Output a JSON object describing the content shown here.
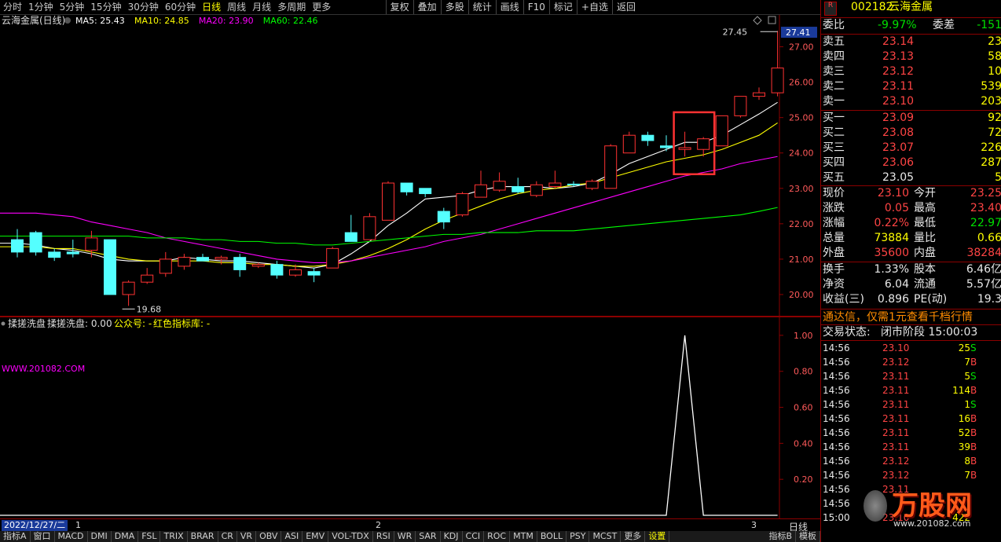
{
  "toolbar": {
    "periods": [
      "分时",
      "1分钟",
      "5分钟",
      "15分钟",
      "30分钟",
      "60分钟",
      "日线",
      "周线",
      "月线",
      "多周期",
      "更多"
    ],
    "active_period": "日线",
    "tools": [
      "复权",
      "叠加",
      "多股",
      "统计",
      "画线",
      "F10",
      "标记",
      "+自选",
      "返回"
    ]
  },
  "main": {
    "stock_title": "云海金属(日线)",
    "ma_labels": [
      {
        "name": "MA5",
        "value": "MA5: 25.43",
        "color": "#ffffff"
      },
      {
        "name": "MA10",
        "value": "MA10: 24.85",
        "color": "#ffff00"
      },
      {
        "name": "MA20",
        "value": "MA20: 23.90",
        "color": "#ff00ff"
      },
      {
        "name": "MA60",
        "value": "MA60: 22.46",
        "color": "#00ff00"
      }
    ],
    "current_price_tag": "27.41",
    "high_annotation": "27.45",
    "low_annotation": "19.68",
    "y_ticks": [
      "27.00",
      "26.00",
      "25.00",
      "24.00",
      "23.00",
      "22.00",
      "21.00",
      "20.00"
    ]
  },
  "sub": {
    "indicator_title": "揉搓洗盘",
    "indicator_value": "揉搓洗盘: 0.00",
    "indicator_extra": "公众号: -",
    "indicator_extra2": "红色指标库: -",
    "watermark_url": "WWW.201082.COM",
    "y_ticks": [
      "1.00",
      "0.80",
      "0.60",
      "0.40",
      "0.20"
    ]
  },
  "bottom": {
    "date": "2022/12/27/二",
    "month_marks": [
      "1",
      "2",
      "3"
    ],
    "period_label": "日线",
    "tabs": [
      "指标A",
      "窗口",
      "MACD",
      "DMI",
      "DMA",
      "FSL",
      "TRIX",
      "BRAR",
      "CR",
      "VR",
      "OBV",
      "ASI",
      "EMV",
      "VOL-TDX",
      "RSI",
      "WR",
      "SAR",
      "KDJ",
      "CCI",
      "ROC",
      "MTM",
      "BOLL",
      "PSY",
      "MCST",
      "更多",
      "设置"
    ],
    "right_tabs": [
      "指标B",
      "模板"
    ]
  },
  "quote": {
    "code": "002182",
    "name": "云海金属",
    "weibi_label": "委比",
    "weibi_value": "-9.97%",
    "weicha_label": "委差",
    "weicha_value": "-151",
    "asks": [
      {
        "label": "卖五",
        "price": "23.14",
        "vol": "23"
      },
      {
        "label": "卖四",
        "price": "23.13",
        "vol": "58"
      },
      {
        "label": "卖三",
        "price": "23.12",
        "vol": "10"
      },
      {
        "label": "卖二",
        "price": "23.11",
        "vol": "539"
      },
      {
        "label": "卖一",
        "price": "23.10",
        "vol": "203"
      }
    ],
    "bids": [
      {
        "label": "买一",
        "price": "23.09",
        "vol": "92"
      },
      {
        "label": "买二",
        "price": "23.08",
        "vol": "72"
      },
      {
        "label": "买三",
        "price": "23.07",
        "vol": "226"
      },
      {
        "label": "买四",
        "price": "23.06",
        "vol": "287"
      },
      {
        "label": "买五",
        "price": "23.05",
        "vol": "5"
      }
    ],
    "stats": [
      {
        "l1": "现价",
        "v1": "23.10",
        "l2": "今开",
        "v2": "23.25"
      },
      {
        "l1": "涨跌",
        "v1": "0.05",
        "l2": "最高",
        "v2": "23.40"
      },
      {
        "l1": "涨幅",
        "v1": "0.22%",
        "l2": "最低",
        "v2": "22.97"
      },
      {
        "l1": "总量",
        "v1": "73884",
        "l2": "量比",
        "v2": "0.66"
      },
      {
        "l1": "外盘",
        "v1": "35600",
        "l2": "内盘",
        "v2": "38284"
      }
    ],
    "stats2": [
      {
        "l1": "换手",
        "v1": "1.33%",
        "l2": "股本",
        "v2": "6.46亿"
      },
      {
        "l1": "净资",
        "v1": "6.04",
        "l2": "流通",
        "v2": "5.57亿"
      },
      {
        "l1": "收益(三)",
        "v1": "0.896",
        "l2": "PE(动)",
        "v2": "19.3"
      }
    ],
    "ad": "通达信，仅需1元查看千档行情",
    "trade_status_label": "交易状态:",
    "trade_status": "闭市阶段 15:00:03",
    "ticks": [
      {
        "t": "14:56",
        "p": "23.10",
        "v": "25",
        "s": "S"
      },
      {
        "t": "14:56",
        "p": "23.12",
        "v": "7",
        "s": "B"
      },
      {
        "t": "14:56",
        "p": "23.11",
        "v": "5",
        "s": "S"
      },
      {
        "t": "14:56",
        "p": "23.11",
        "v": "114",
        "s": "B"
      },
      {
        "t": "14:56",
        "p": "23.11",
        "v": "1",
        "s": "S"
      },
      {
        "t": "14:56",
        "p": "23.11",
        "v": "16",
        "s": "B"
      },
      {
        "t": "14:56",
        "p": "23.11",
        "v": "52",
        "s": "B"
      },
      {
        "t": "14:56",
        "p": "23.11",
        "v": "39",
        "s": "B"
      },
      {
        "t": "14:56",
        "p": "23.12",
        "v": "8",
        "s": "B"
      },
      {
        "t": "14:56",
        "p": "23.12",
        "v": "7",
        "s": "B"
      },
      {
        "t": "14:56",
        "p": "23.11",
        "v": "",
        "s": ""
      },
      {
        "t": "14:56",
        "p": "",
        "v": "",
        "s": ""
      },
      {
        "t": "15:00",
        "p": "23.10",
        "v": "422",
        "s": ""
      }
    ],
    "brand_watermark": "万股网",
    "brand_url": "www.201082.com"
  },
  "chart_data": {
    "type": "candlestick",
    "candles": [
      {
        "o": 21.55,
        "h": 21.85,
        "l": 21.05,
        "c": 21.2
      },
      {
        "o": 21.75,
        "h": 21.8,
        "l": 21.1,
        "c": 21.2
      },
      {
        "o": 21.2,
        "h": 21.3,
        "l": 20.95,
        "c": 21.05
      },
      {
        "o": 21.2,
        "h": 21.55,
        "l": 21.05,
        "c": 21.15
      },
      {
        "o": 21.25,
        "h": 21.8,
        "l": 21.05,
        "c": 21.6
      },
      {
        "o": 21.55,
        "h": 21.55,
        "l": 20.0,
        "c": 20.0
      },
      {
        "o": 20.0,
        "h": 20.4,
        "l": 19.68,
        "c": 20.35
      },
      {
        "o": 20.35,
        "h": 20.75,
        "l": 20.3,
        "c": 20.55
      },
      {
        "o": 20.6,
        "h": 21.2,
        "l": 20.5,
        "c": 21.0
      },
      {
        "o": 20.8,
        "h": 21.15,
        "l": 20.7,
        "c": 21.05
      },
      {
        "o": 21.05,
        "h": 21.15,
        "l": 20.95,
        "c": 20.95
      },
      {
        "o": 21.0,
        "h": 21.1,
        "l": 20.85,
        "c": 21.05
      },
      {
        "o": 21.05,
        "h": 21.15,
        "l": 20.5,
        "c": 20.7
      },
      {
        "o": 20.8,
        "h": 20.9,
        "l": 20.75,
        "c": 20.85
      },
      {
        "o": 20.85,
        "h": 20.95,
        "l": 20.45,
        "c": 20.55
      },
      {
        "o": 20.55,
        "h": 20.85,
        "l": 20.5,
        "c": 20.7
      },
      {
        "o": 20.65,
        "h": 20.75,
        "l": 20.35,
        "c": 20.55
      },
      {
        "o": 20.75,
        "h": 21.35,
        "l": 20.75,
        "c": 21.3
      },
      {
        "o": 21.75,
        "h": 22.25,
        "l": 21.5,
        "c": 21.5
      },
      {
        "o": 21.55,
        "h": 22.3,
        "l": 21.55,
        "c": 22.2
      },
      {
        "o": 22.1,
        "h": 23.2,
        "l": 22.1,
        "c": 23.15
      },
      {
        "o": 23.15,
        "h": 23.15,
        "l": 22.8,
        "c": 22.9
      },
      {
        "o": 23.0,
        "h": 23.0,
        "l": 22.75,
        "c": 22.85
      },
      {
        "o": 22.35,
        "h": 22.45,
        "l": 21.85,
        "c": 22.05
      },
      {
        "o": 22.25,
        "h": 22.9,
        "l": 22.2,
        "c": 22.85
      },
      {
        "o": 22.75,
        "h": 23.5,
        "l": 22.75,
        "c": 23.1
      },
      {
        "o": 22.95,
        "h": 23.45,
        "l": 22.9,
        "c": 23.2
      },
      {
        "o": 23.05,
        "h": 23.3,
        "l": 22.85,
        "c": 22.9
      },
      {
        "o": 22.8,
        "h": 23.2,
        "l": 22.75,
        "c": 23.1
      },
      {
        "o": 23.05,
        "h": 23.5,
        "l": 23.0,
        "c": 23.15
      },
      {
        "o": 23.12,
        "h": 23.2,
        "l": 23.05,
        "c": 23.1
      },
      {
        "o": 23.0,
        "h": 23.25,
        "l": 22.95,
        "c": 23.2
      },
      {
        "o": 23.0,
        "h": 24.25,
        "l": 23.0,
        "c": 24.2
      },
      {
        "o": 24.0,
        "h": 24.6,
        "l": 24.0,
        "c": 24.5
      },
      {
        "o": 24.5,
        "h": 24.6,
        "l": 24.2,
        "c": 24.35
      },
      {
        "o": 24.2,
        "h": 24.5,
        "l": 24.05,
        "c": 24.15
      },
      {
        "o": 24.1,
        "h": 24.6,
        "l": 23.9,
        "c": 24.15
      },
      {
        "o": 24.1,
        "h": 24.45,
        "l": 23.9,
        "c": 24.4
      },
      {
        "o": 24.2,
        "h": 24.95,
        "l": 24.2,
        "c": 25.05
      },
      {
        "o": 25.05,
        "h": 25.6,
        "l": 25.0,
        "c": 25.6
      },
      {
        "o": 25.6,
        "h": 25.85,
        "l": 25.5,
        "c": 25.7
      },
      {
        "o": 25.7,
        "h": 27.45,
        "l": 25.6,
        "c": 26.4
      }
    ],
    "ylim": [
      19.4,
      27.9
    ],
    "ma": {
      "MA5": [
        21.45,
        21.4,
        21.3,
        21.25,
        21.15,
        21.0,
        20.95,
        20.95,
        20.95,
        21.05,
        21.0,
        20.95,
        20.95,
        20.9,
        20.85,
        20.8,
        20.75,
        20.85,
        21.15,
        21.5,
        21.95,
        22.3,
        22.7,
        22.75,
        22.8,
        22.95,
        23.05,
        23.05,
        23.05,
        23.0,
        23.05,
        23.15,
        23.4,
        23.7,
        23.9,
        24.1,
        24.3,
        24.3,
        24.5,
        24.8,
        25.1,
        25.43
      ],
      "MA10": [
        21.35,
        21.35,
        21.3,
        21.3,
        21.2,
        21.1,
        21.0,
        20.95,
        20.95,
        20.95,
        20.95,
        20.9,
        20.9,
        20.85,
        20.85,
        20.8,
        20.8,
        20.85,
        20.95,
        21.1,
        21.3,
        21.55,
        21.85,
        22.1,
        22.3,
        22.5,
        22.7,
        22.85,
        22.95,
        23.0,
        23.1,
        23.15,
        23.3,
        23.45,
        23.6,
        23.75,
        23.85,
        23.95,
        24.1,
        24.3,
        24.5,
        24.85
      ],
      "MA20": [
        22.3,
        22.3,
        22.25,
        22.2,
        22.05,
        21.95,
        21.85,
        21.75,
        21.6,
        21.5,
        21.4,
        21.3,
        21.2,
        21.1,
        21.0,
        20.95,
        20.9,
        20.9,
        20.95,
        21.05,
        21.15,
        21.25,
        21.35,
        21.5,
        21.6,
        21.7,
        21.85,
        22.0,
        22.15,
        22.3,
        22.45,
        22.6,
        22.75,
        22.9,
        23.05,
        23.2,
        23.35,
        23.45,
        23.55,
        23.7,
        23.8,
        23.9
      ],
      "MA60": [
        21.65,
        21.65,
        21.65,
        21.65,
        21.65,
        21.65,
        21.65,
        21.6,
        21.6,
        21.6,
        21.55,
        21.55,
        21.5,
        21.5,
        21.45,
        21.45,
        21.4,
        21.4,
        21.45,
        21.5,
        21.55,
        21.6,
        21.65,
        21.7,
        21.7,
        21.75,
        21.75,
        21.75,
        21.8,
        21.8,
        21.8,
        21.85,
        21.9,
        21.95,
        22.0,
        22.05,
        22.1,
        22.15,
        22.2,
        22.25,
        22.35,
        22.46
      ]
    },
    "highlight_candles": [
      36,
      37
    ],
    "indicator": {
      "name": "揉搓洗盘",
      "ylim": [
        0,
        1.1
      ],
      "values": [
        0,
        0,
        0,
        0,
        0,
        0,
        0,
        0,
        0,
        0,
        0,
        0,
        0,
        0,
        0,
        0,
        0,
        0,
        0,
        0,
        0,
        0,
        0,
        0,
        0,
        0,
        0,
        0,
        0,
        0,
        0,
        0,
        0,
        0,
        0,
        0,
        1,
        0,
        0,
        0,
        0,
        0
      ]
    }
  },
  "colors": {
    "up": "#ff3232",
    "down": "#54ffff",
    "ma5": "#ffffff",
    "ma10": "#ffff00",
    "ma20": "#ff00ff",
    "ma60": "#00ff00",
    "grid": "#8b0000"
  }
}
